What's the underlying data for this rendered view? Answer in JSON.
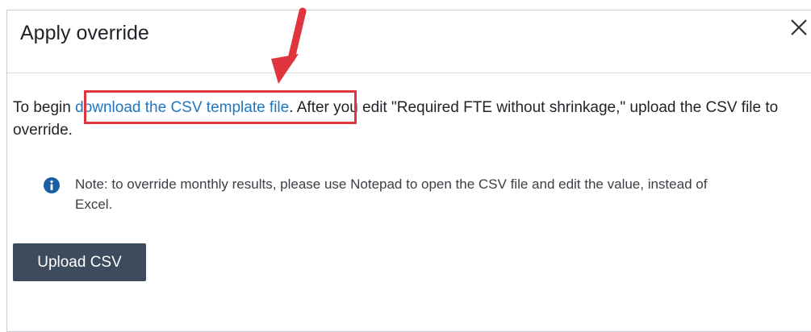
{
  "dialog": {
    "title": "Apply override",
    "close_icon": "close-icon"
  },
  "instructions": {
    "prefix": "To begin ",
    "link_text": "download the CSV template file",
    "suffix": ". After you edit \"Required FTE without shrinkage,\" upload the CSV file to override."
  },
  "note": {
    "icon": "info-icon",
    "text": "Note: to override monthly results, please use Notepad to open the CSV file and edit the value, instead of Excel."
  },
  "actions": {
    "upload_label": "Upload CSV"
  },
  "colors": {
    "link": "#1f76c2",
    "annotation": "#e0353d",
    "button": "#3d4b5c",
    "info_icon": "#1a5ea3"
  }
}
